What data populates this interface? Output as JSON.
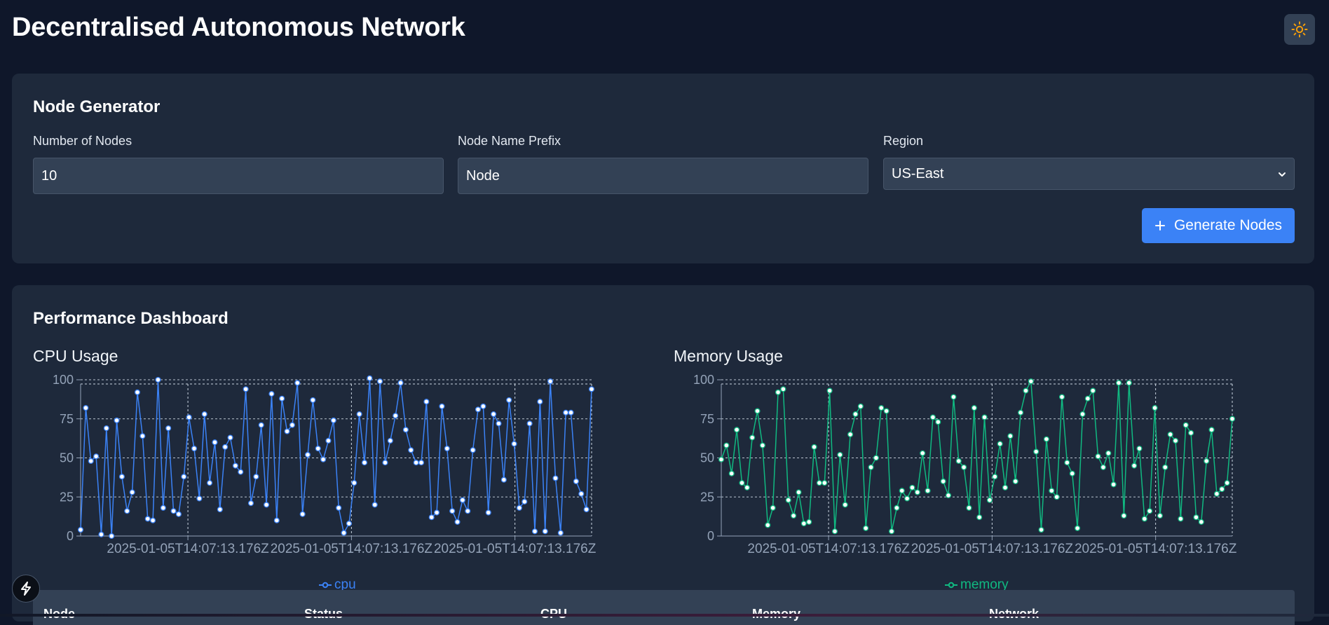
{
  "header": {
    "title": "Decentralised Autonomous Network",
    "theme_icon": "sun-icon",
    "theme_icon_color": "#f59e0b"
  },
  "generator": {
    "title": "Node Generator",
    "count_label": "Number of Nodes",
    "count_value": "10",
    "prefix_label": "Node Name Prefix",
    "prefix_value": "Node",
    "region_label": "Region",
    "region_value": "US-East",
    "button_icon": "plus-icon",
    "button_label": "Generate Nodes",
    "accent": "#3b82f6"
  },
  "dashboard": {
    "title": "Performance Dashboard",
    "table_headers": [
      "Node",
      "Status",
      "CPU",
      "Memory",
      "Network"
    ]
  },
  "chart_data": [
    {
      "type": "line",
      "title": "CPU Usage",
      "color": "#3b82f6",
      "series": [
        {
          "name": "cpu",
          "values": [
            4,
            82,
            48,
            51,
            1,
            69,
            0,
            74,
            38,
            16,
            28,
            92,
            64,
            11,
            10,
            100,
            18,
            69,
            16,
            14,
            38,
            76,
            56,
            24,
            78,
            34,
            60,
            17,
            57,
            63,
            45,
            41,
            94,
            21,
            38,
            71,
            20,
            91,
            10,
            88,
            67,
            71,
            98,
            14,
            52,
            87,
            56,
            49,
            61,
            74,
            18,
            2,
            8,
            34,
            78,
            47,
            101,
            20,
            99,
            47,
            61,
            77,
            98,
            68,
            55,
            47,
            47,
            86,
            12,
            15,
            83,
            56,
            16,
            9,
            23,
            16,
            55,
            81,
            83,
            15,
            78,
            72,
            36,
            87,
            59,
            18,
            22,
            72,
            3,
            86,
            3,
            99,
            37,
            2,
            79,
            79,
            35,
            27,
            17,
            94
          ]
        }
      ],
      "x_tick_labels": [
        "2025-01-05T14:07:13.176Z",
        "2025-01-05T14:07:13.176Z",
        "2025-01-05T14:07:13.176Z"
      ],
      "y_ticks": [
        0,
        25,
        50,
        75,
        100
      ],
      "ylim": [
        0,
        100
      ],
      "grid": true,
      "legend_position": "bottom"
    },
    {
      "type": "line",
      "title": "Memory Usage",
      "color": "#10b981",
      "series": [
        {
          "name": "memory",
          "values": [
            49,
            58,
            40,
            68,
            34,
            31,
            63,
            80,
            58,
            7,
            18,
            92,
            94,
            23,
            13,
            28,
            8,
            9,
            57,
            34,
            34,
            93,
            3,
            52,
            20,
            65,
            78,
            83,
            5,
            44,
            50,
            82,
            80,
            3,
            18,
            29,
            24,
            31,
            28,
            53,
            29,
            76,
            73,
            35,
            26,
            89,
            48,
            44,
            18,
            82,
            12,
            76,
            23,
            38,
            59,
            31,
            64,
            35,
            79,
            93,
            99,
            54,
            4,
            62,
            29,
            25,
            89,
            47,
            40,
            5,
            78,
            88,
            93,
            51,
            44,
            53,
            33,
            98,
            13,
            98,
            45,
            56,
            11,
            16,
            82,
            13,
            44,
            65,
            61,
            11,
            71,
            66,
            12,
            9,
            48,
            68,
            27,
            30,
            34,
            75
          ]
        }
      ],
      "x_tick_labels": [
        "2025-01-05T14:07:13.176Z",
        "2025-01-05T14:07:13.176Z",
        "2025-01-05T14:07:13.176Z"
      ],
      "y_ticks": [
        0,
        25,
        50,
        75,
        100
      ],
      "ylim": [
        0,
        100
      ],
      "grid": true,
      "legend_position": "bottom"
    }
  ]
}
